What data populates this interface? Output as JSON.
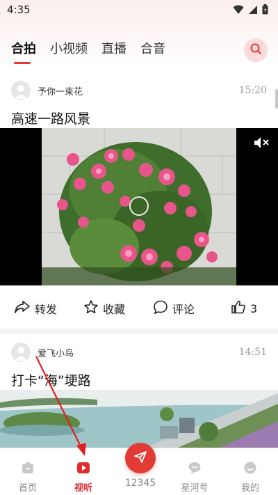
{
  "status_bar": {
    "time": "4:35",
    "icons": [
      "wifi-icon",
      "signal-icon",
      "battery-icon"
    ]
  },
  "tabs": [
    {
      "label": "合拍",
      "active": true
    },
    {
      "label": "小视频",
      "active": false
    },
    {
      "label": "直播",
      "active": false
    },
    {
      "label": "合音",
      "active": false
    }
  ],
  "search": {
    "icon": "search-icon"
  },
  "posts": [
    {
      "author": "予你一束花",
      "time": "15:20",
      "title": "高速一路风景",
      "media": "video",
      "muted": true,
      "actions": {
        "share_label": "转发",
        "favorite_label": "收藏",
        "comment_label": "评论",
        "like_count": "3"
      }
    },
    {
      "author": "爱飞小鸟",
      "time": "14:51",
      "title": "打卡“海”埂路",
      "media": "image"
    }
  ],
  "bottom_nav": [
    {
      "label": "首页",
      "icon": "home-icon",
      "active": false
    },
    {
      "label": "视听",
      "icon": "play-icon",
      "active": true
    },
    {
      "label": "12345",
      "icon": "paper-plane-icon",
      "active": false
    },
    {
      "label": "星河号",
      "icon": "chat-bubble-icon",
      "active": false
    },
    {
      "label": "我的",
      "icon": "profile-icon",
      "active": false
    }
  ],
  "colors": {
    "accent": "#e53535",
    "header_gradient_top": "#fbeeee",
    "center_button": "#e23b36",
    "annotation_arrow": "#e02020"
  }
}
